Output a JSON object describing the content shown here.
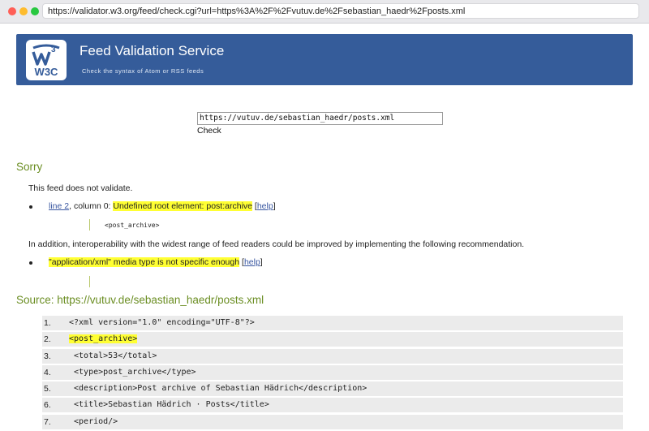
{
  "browser": {
    "url": "https://validator.w3.org/feed/check.cgi?url=https%3A%2F%2Fvutuv.de%2Fsebastian_haedr%2Fposts.xml"
  },
  "header": {
    "logo_text": "W3C",
    "title": "Feed Validation Service",
    "subtitle": "Check the syntax of Atom or RSS feeds"
  },
  "form": {
    "url_value": "https://vutuv.de/sebastian_haedr/posts.xml",
    "check_label": "Check"
  },
  "result": {
    "heading": "Sorry",
    "summary": "This feed does not validate.",
    "error": {
      "link_text": "line 2",
      "location_rest": ", column 0: ",
      "message": "Undefined root element: post:archive",
      "help_open": " [",
      "help_label": "help",
      "help_close": "]",
      "snippet": "<post_archive>"
    },
    "recommendation_intro": "In addition, interoperability with the widest range of feed readers could be improved by implementing the following recommendation.",
    "recommendation": {
      "message": "\"application/xml\" media type is not specific enough",
      "help_open": " [",
      "help_label": "help",
      "help_close": "]"
    }
  },
  "source": {
    "heading": "Source: https://vutuv.de/sebastian_haedr/posts.xml",
    "lines": [
      {
        "num": "1.",
        "code": "<?xml version=\"1.0\" encoding=\"UTF-8\"?>"
      },
      {
        "num": "2.",
        "code": "<post_archive>"
      },
      {
        "num": "3.",
        "code": " <total>53</total>"
      },
      {
        "num": "4.",
        "code": " <type>post_archive</type>"
      },
      {
        "num": "5.",
        "code": " <description>Post archive of Sebastian Hädrich</description>"
      },
      {
        "num": "6.",
        "code": " <title>Sebastian Hädrich · Posts</title>"
      },
      {
        "num": "7.",
        "code": " <period/>"
      }
    ]
  },
  "colors": {
    "banner": "#355c9a",
    "heading_green": "#6b8e23",
    "highlight": "#ffff33",
    "link": "#3856a0"
  }
}
